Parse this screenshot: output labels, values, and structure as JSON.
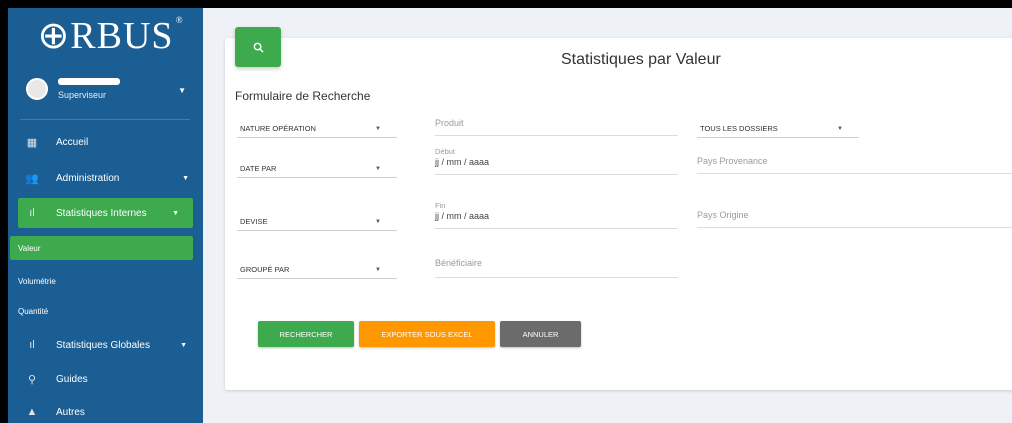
{
  "sidebar": {
    "logo": "⊕RBUS",
    "logo_mark": "®",
    "user_role": "Superviseur",
    "items": [
      {
        "label": "Accueil",
        "icon": "dashboard-icon"
      },
      {
        "label": "Administration",
        "icon": "users-icon"
      },
      {
        "label": "Statistiques Internes",
        "icon": "bar-chart-icon"
      },
      {
        "label": "Statistiques Globales",
        "icon": "bar-chart-icon"
      },
      {
        "label": "Guides",
        "icon": "search-icon"
      },
      {
        "label": "Autres",
        "icon": "triangle-icon"
      }
    ],
    "sub_items": [
      {
        "label": "Valeur"
      },
      {
        "label": "Volumétrie"
      },
      {
        "label": "Quantité"
      }
    ]
  },
  "main": {
    "title": "Statistiques par Valeur",
    "form_title": "Formulaire de Recherche",
    "selects": {
      "nature": "NATURE OPÉRATION",
      "date_par": "DATE PAR",
      "devise": "DEVISE",
      "groupe_par": "GROUPÉ PAR",
      "dossiers": "TOUS LES DOSSIERS"
    },
    "fields": {
      "produit": "Produit",
      "debut_label": "Début",
      "debut_value": "jj / mm / aaaa",
      "fin_label": "Fin",
      "fin_value": "jj / mm / aaaa",
      "beneficiaire": "Bénéficiaire",
      "pays_provenance": "Pays Provenance",
      "pays_origine": "Pays Origine"
    },
    "buttons": {
      "rechercher": "RECHERCHER",
      "exporter": "EXPORTER SOUS EXCEL",
      "annuler": "ANNULER"
    }
  },
  "colors": {
    "sidebar": "#1b5e94",
    "accent_green": "#3daa4e",
    "export_orange": "#ff9800",
    "cancel_gray": "#6b6b6b"
  }
}
